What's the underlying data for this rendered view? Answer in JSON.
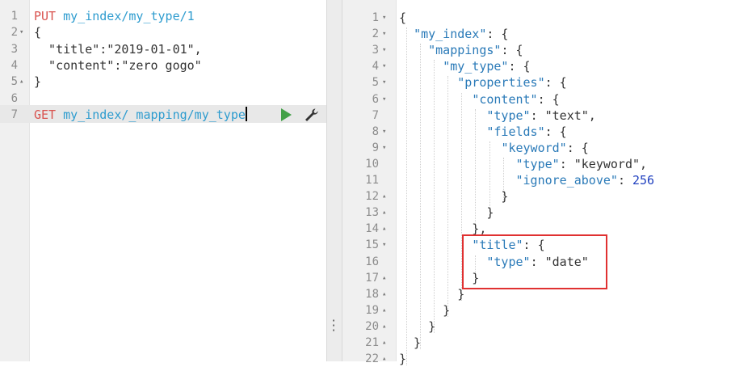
{
  "request_editor": {
    "lines": [
      {
        "n": "1",
        "fold": "",
        "parts": [
          {
            "t": "PUT",
            "c": "kw"
          },
          {
            "t": " ",
            "c": "str"
          },
          {
            "t": "my_index/my_type/1",
            "c": "url"
          }
        ]
      },
      {
        "n": "2",
        "fold": "▾",
        "parts": [
          {
            "t": "{",
            "c": "str"
          }
        ]
      },
      {
        "n": "3",
        "fold": "",
        "parts": [
          {
            "t": "  \"title\":\"2019-01-01\",",
            "c": "str"
          }
        ]
      },
      {
        "n": "4",
        "fold": "",
        "parts": [
          {
            "t": "  \"content\":\"zero gogo\"",
            "c": "str"
          }
        ]
      },
      {
        "n": "5",
        "fold": "▴",
        "parts": [
          {
            "t": "}",
            "c": "str"
          }
        ]
      },
      {
        "n": "6",
        "fold": "",
        "parts": []
      },
      {
        "n": "7",
        "fold": "",
        "parts": [
          {
            "t": "GET",
            "c": "kw"
          },
          {
            "t": " ",
            "c": "str"
          },
          {
            "t": "my_index/_mapping/my_type",
            "c": "url"
          }
        ]
      }
    ],
    "run_icon": "play-icon",
    "settings_icon": "wrench-icon"
  },
  "response_editor": {
    "lines": [
      {
        "n": "1",
        "fold": "▾",
        "parts": [
          {
            "t": "{",
            "c": "val"
          }
        ]
      },
      {
        "n": "2",
        "fold": "▾",
        "parts": [
          {
            "t": "  ",
            "c": "val"
          },
          {
            "t": "\"my_index\"",
            "c": "key"
          },
          {
            "t": ": {",
            "c": "val"
          }
        ]
      },
      {
        "n": "3",
        "fold": "▾",
        "parts": [
          {
            "t": "    ",
            "c": "val"
          },
          {
            "t": "\"mappings\"",
            "c": "key"
          },
          {
            "t": ": {",
            "c": "val"
          }
        ]
      },
      {
        "n": "4",
        "fold": "▾",
        "parts": [
          {
            "t": "      ",
            "c": "val"
          },
          {
            "t": "\"my_type\"",
            "c": "key"
          },
          {
            "t": ": {",
            "c": "val"
          }
        ]
      },
      {
        "n": "5",
        "fold": "▾",
        "parts": [
          {
            "t": "        ",
            "c": "val"
          },
          {
            "t": "\"properties\"",
            "c": "key"
          },
          {
            "t": ": {",
            "c": "val"
          }
        ]
      },
      {
        "n": "6",
        "fold": "▾",
        "parts": [
          {
            "t": "          ",
            "c": "val"
          },
          {
            "t": "\"content\"",
            "c": "key"
          },
          {
            "t": ": {",
            "c": "val"
          }
        ]
      },
      {
        "n": "7",
        "fold": "",
        "parts": [
          {
            "t": "            ",
            "c": "val"
          },
          {
            "t": "\"type\"",
            "c": "key"
          },
          {
            "t": ": \"text\",",
            "c": "val"
          }
        ]
      },
      {
        "n": "8",
        "fold": "▾",
        "parts": [
          {
            "t": "            ",
            "c": "val"
          },
          {
            "t": "\"fields\"",
            "c": "key"
          },
          {
            "t": ": {",
            "c": "val"
          }
        ]
      },
      {
        "n": "9",
        "fold": "▾",
        "parts": [
          {
            "t": "              ",
            "c": "val"
          },
          {
            "t": "\"keyword\"",
            "c": "key"
          },
          {
            "t": ": {",
            "c": "val"
          }
        ]
      },
      {
        "n": "10",
        "fold": "",
        "parts": [
          {
            "t": "                ",
            "c": "val"
          },
          {
            "t": "\"type\"",
            "c": "key"
          },
          {
            "t": ": \"keyword\",",
            "c": "val"
          }
        ]
      },
      {
        "n": "11",
        "fold": "",
        "parts": [
          {
            "t": "                ",
            "c": "val"
          },
          {
            "t": "\"ignore_above\"",
            "c": "key"
          },
          {
            "t": ": ",
            "c": "val"
          },
          {
            "t": "256",
            "c": "num"
          }
        ]
      },
      {
        "n": "12",
        "fold": "▴",
        "parts": [
          {
            "t": "              }",
            "c": "val"
          }
        ]
      },
      {
        "n": "13",
        "fold": "▴",
        "parts": [
          {
            "t": "            }",
            "c": "val"
          }
        ]
      },
      {
        "n": "14",
        "fold": "▴",
        "parts": [
          {
            "t": "          },",
            "c": "val"
          }
        ]
      },
      {
        "n": "15",
        "fold": "▾",
        "parts": [
          {
            "t": "          ",
            "c": "val"
          },
          {
            "t": "\"title\"",
            "c": "key"
          },
          {
            "t": ": {",
            "c": "val"
          }
        ]
      },
      {
        "n": "16",
        "fold": "",
        "parts": [
          {
            "t": "            ",
            "c": "val"
          },
          {
            "t": "\"type\"",
            "c": "key"
          },
          {
            "t": ": \"date\"",
            "c": "val"
          }
        ]
      },
      {
        "n": "17",
        "fold": "▴",
        "parts": [
          {
            "t": "          }",
            "c": "val"
          }
        ]
      },
      {
        "n": "18",
        "fold": "▴",
        "parts": [
          {
            "t": "        }",
            "c": "val"
          }
        ]
      },
      {
        "n": "19",
        "fold": "▴",
        "parts": [
          {
            "t": "      }",
            "c": "val"
          }
        ]
      },
      {
        "n": "20",
        "fold": "▴",
        "parts": [
          {
            "t": "    }",
            "c": "val"
          }
        ]
      },
      {
        "n": "21",
        "fold": "▴",
        "parts": [
          {
            "t": "  }",
            "c": "val"
          }
        ]
      },
      {
        "n": "22",
        "fold": "▴",
        "parts": [
          {
            "t": "}",
            "c": "val"
          }
        ]
      }
    ]
  },
  "colors": {
    "method": "#d9534f",
    "url": "#2e9ccf",
    "key": "#2a7ab8",
    "number": "#1f3fbf",
    "run": "#43a047",
    "highlight_box": "#e03131"
  },
  "splitter_icon": "vertical-dots-icon"
}
